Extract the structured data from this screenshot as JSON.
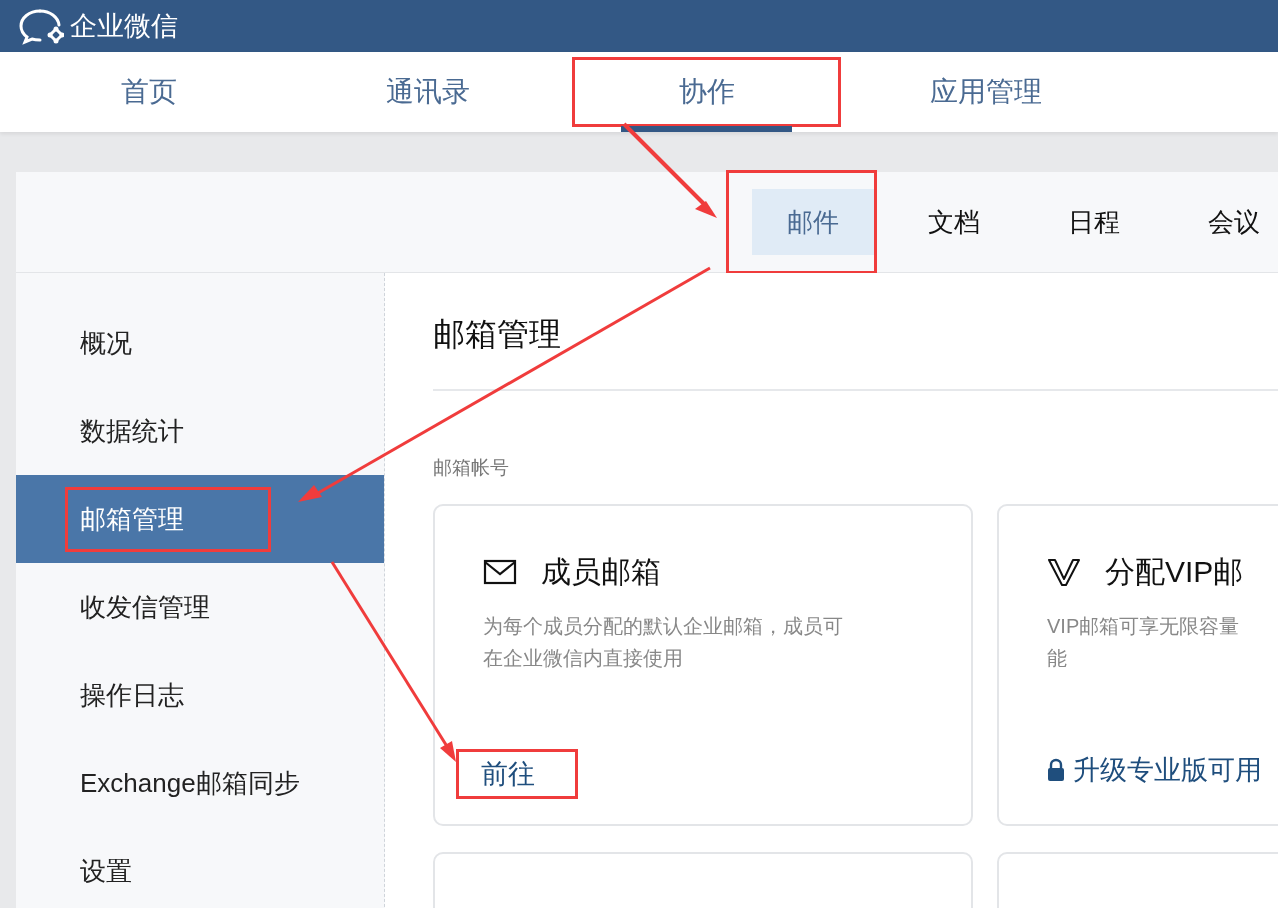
{
  "app": {
    "name": "企业微信"
  },
  "nav": [
    {
      "label": "首页",
      "selected": false,
      "annotated": false
    },
    {
      "label": "通讯录",
      "selected": false,
      "annotated": false
    },
    {
      "label": "协作",
      "selected": true,
      "annotated": true
    },
    {
      "label": "应用管理",
      "selected": false,
      "annotated": false
    }
  ],
  "subnav": [
    {
      "label": "邮件",
      "selected": true,
      "annotated": true
    },
    {
      "label": "文档",
      "selected": false,
      "annotated": false
    },
    {
      "label": "日程",
      "selected": false,
      "annotated": false
    },
    {
      "label": "会议",
      "selected": false,
      "annotated": false
    }
  ],
  "sidebar": [
    {
      "label": "概况",
      "selected": false,
      "annotated": false
    },
    {
      "label": "数据统计",
      "selected": false,
      "annotated": false
    },
    {
      "label": "邮箱管理",
      "selected": true,
      "annotated": true
    },
    {
      "label": "收发信管理",
      "selected": false,
      "annotated": false
    },
    {
      "label": "操作日志",
      "selected": false,
      "annotated": false
    },
    {
      "label": "Exchange邮箱同步",
      "selected": false,
      "annotated": false
    },
    {
      "label": "设置",
      "selected": false,
      "annotated": false
    }
  ],
  "page": {
    "title": "邮箱管理",
    "section": "邮箱帐号"
  },
  "cards": [
    {
      "kind": "mail",
      "title": "成员邮箱",
      "description": "为每个成员分配的默认企业邮箱，成员可在企业微信内直接使用",
      "action": "前往",
      "locked": false,
      "annotated": true
    },
    {
      "kind": "vip",
      "title": "分配VIP邮",
      "description": "VIP邮箱可享无限容量能",
      "action": "升级专业版可用",
      "locked": true,
      "annotated": false
    },
    {
      "kind": "blank"
    },
    {
      "kind": "blank"
    }
  ]
}
